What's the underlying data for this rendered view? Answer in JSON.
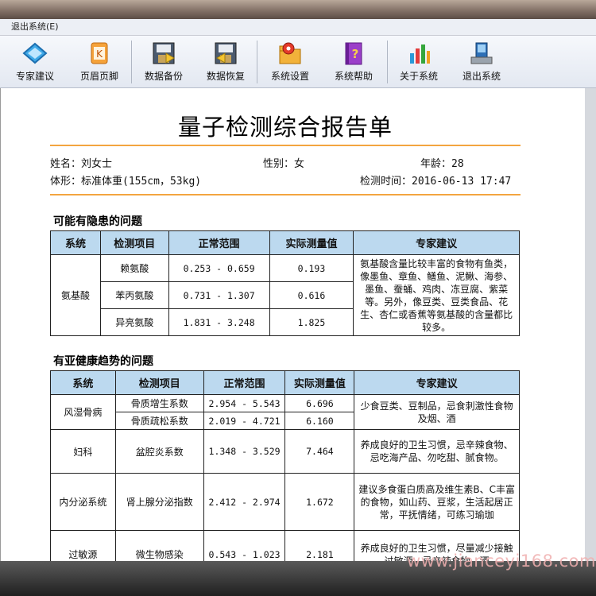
{
  "menu": {
    "exit": "退出系统(E)"
  },
  "toolbar": {
    "buttons": [
      {
        "label": "专家建议",
        "icon": "expert-advice-icon"
      },
      {
        "label": "页眉页脚",
        "icon": "header-footer-icon"
      },
      {
        "label": "数据备份",
        "icon": "data-backup-icon"
      },
      {
        "label": "数据恢复",
        "icon": "data-restore-icon"
      },
      {
        "label": "系统设置",
        "icon": "system-settings-icon"
      },
      {
        "label": "系统帮助",
        "icon": "help-book-icon"
      },
      {
        "label": "关于系统",
        "icon": "about-chart-icon"
      },
      {
        "label": "退出系统",
        "icon": "exit-computer-icon"
      }
    ]
  },
  "report": {
    "title": "量子检测综合报告单",
    "name": "姓名：刘女士",
    "gender": "性别：女",
    "age": "年龄：28",
    "body": "体形：标准体重(155cm，53kg)",
    "time": "检测时间：2016-06-13 17:47"
  },
  "section1": {
    "title": "可能有隐患的问题",
    "headers": [
      "系统",
      "检测项目",
      "正常范围",
      "实际测量值",
      "专家建议"
    ],
    "system": "氨基酸",
    "rows": [
      {
        "item": "赖氨酸",
        "range": "0.253 - 0.659",
        "value": "0.193"
      },
      {
        "item": "苯丙氨酸",
        "range": "0.731 - 1.307",
        "value": "0.616"
      },
      {
        "item": "异亮氨酸",
        "range": "1.831 - 3.248",
        "value": "1.825"
      }
    ],
    "advice": "氨基酸含量比较丰富的食物有鱼类，像墨鱼、章鱼、鳝鱼、泥鳅、海参、墨鱼、蚕蛹、鸡肉、冻豆腐、紫菜等。另外，像豆类、豆类食品、花生、杏仁或香蕉等氨基酸的含量都比较多。"
  },
  "section2": {
    "title": "有亚健康趋势的问题",
    "headers": [
      "系统",
      "检测项目",
      "正常范围",
      "实际测量值",
      "专家建议"
    ],
    "groups": [
      {
        "system": "风湿骨病",
        "rows": [
          {
            "item": "骨质增生系数",
            "range": "2.954 - 5.543",
            "value": "6.696"
          },
          {
            "item": "骨质疏松系数",
            "range": "2.019 - 4.721",
            "value": "6.160"
          }
        ],
        "advice": "少食豆类、豆制品，忌食刺激性食物及烟、酒"
      },
      {
        "system": "妇科",
        "rows": [
          {
            "item": "盆腔炎系数",
            "range": "1.348 - 3.529",
            "value": "7.464"
          }
        ],
        "advice": "养成良好的卫生习惯，忌辛辣食物、忌吃海产品、勿吃甜、腻食物。"
      },
      {
        "system": "内分泌系统",
        "rows": [
          {
            "item": "肾上腺分泌指数",
            "range": "2.412 - 2.974",
            "value": "1.672"
          }
        ],
        "advice": "建议多食蛋白质高及维生素B、C丰富的食物，如山药、豆浆，生活起居正常，平抚情绪，可练习瑜珈"
      },
      {
        "system": "过敏源",
        "rows": [
          {
            "item": "微生物感染",
            "range": "0.543 - 1.023",
            "value": "2.181"
          }
        ],
        "advice": "养成良好的卫生习惯，尽量减少接触过敏源。忌辛辣食物、酒"
      }
    ]
  },
  "watermark": "www.jianceyi168.com"
}
